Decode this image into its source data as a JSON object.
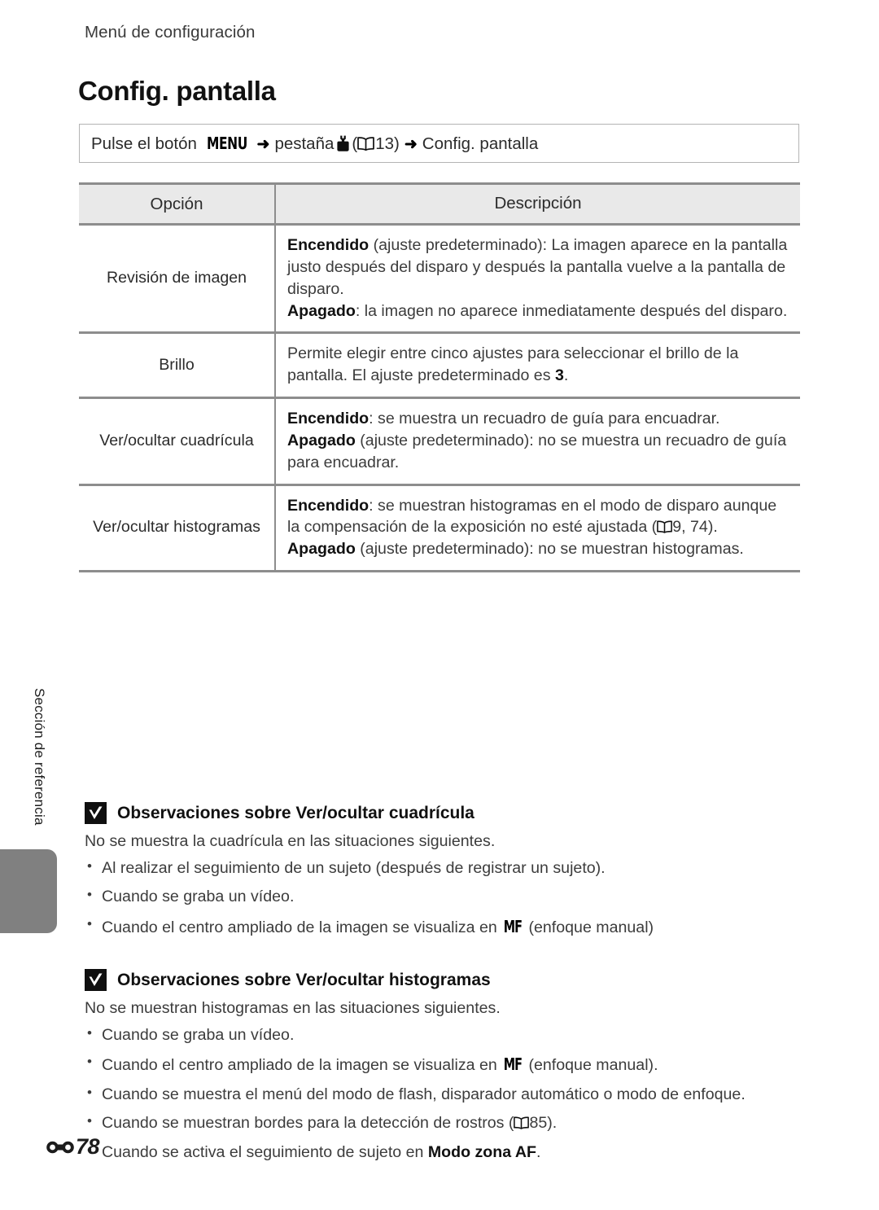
{
  "header": {
    "running_title": "Menú de configuración"
  },
  "page_title": "Config. pantalla",
  "path_bar": {
    "prefix": "Pulse el botón",
    "menu_button": "MENU",
    "arrow": "➜",
    "tab_word": "pestaña",
    "wrench_icon": "wrench-icon",
    "book_icon": "book-icon",
    "page_ref": "13",
    "open_paren": "(",
    "close_paren": ")",
    "arrow2": "➜",
    "destination": "Config. pantalla"
  },
  "table": {
    "headers": {
      "option": "Opción",
      "description": "Descripción"
    },
    "rows": [
      {
        "option": "Revisión de imagen",
        "lines": [
          {
            "bold": "Encendido",
            "rest": " (ajuste predeterminado): La imagen aparece en la pantalla justo después del disparo y después la pantalla vuelve a la pantalla de disparo."
          },
          {
            "bold": "Apagado",
            "rest": ": la imagen no aparece inmediatamente después del disparo."
          }
        ]
      },
      {
        "option": "Brillo",
        "lines": [
          {
            "bold": "",
            "rest": "Permite elegir entre cinco ajustes para seleccionar el brillo de la pantalla. El ajuste predeterminado es ",
            "trail_bold": "3",
            "trail": "."
          }
        ]
      },
      {
        "option": "Ver/ocultar cuadrícula",
        "lines": [
          {
            "bold": "Encendido",
            "rest": ": se muestra un recuadro de guía para encuadrar."
          },
          {
            "bold": "Apagado",
            "rest": " (ajuste predeterminado): no se muestra un recuadro de guía para encuadrar."
          }
        ]
      },
      {
        "option": "Ver/ocultar histogramas",
        "lines": [
          {
            "bold": "Encendido",
            "rest": ": se muestran histogramas en el modo de disparo aunque la compensación de la exposición no esté ajustada (",
            "book": "book-icon",
            "page_ref": "9, 74",
            "tail": ")."
          },
          {
            "bold": "Apagado",
            "rest": " (ajuste predeterminado): no se muestran histogramas."
          }
        ]
      }
    ]
  },
  "side_tab": {
    "label": "Sección de referencia"
  },
  "notes": [
    {
      "icon": "check-square-icon",
      "heading": "Observaciones sobre Ver/ocultar cuadrícula",
      "intro": "No se muestra la cuadrícula en las situaciones siguientes.",
      "bullets": [
        {
          "text": "Al realizar el seguimiento de un sujeto (después de registrar un sujeto)."
        },
        {
          "text": "Cuando se graba un vídeo."
        },
        {
          "pre": "Cuando el centro ampliado de la imagen se visualiza en ",
          "glyph": "MF",
          "post": " (enfoque manual)"
        }
      ]
    },
    {
      "icon": "check-square-icon",
      "heading": "Observaciones sobre Ver/ocultar histogramas",
      "intro": "No se muestran histogramas en las situaciones siguientes.",
      "bullets": [
        {
          "text": "Cuando se graba un vídeo."
        },
        {
          "pre": "Cuando el centro ampliado de la imagen se visualiza en ",
          "glyph": "MF",
          "post": " (enfoque manual)."
        },
        {
          "text": "Cuando se muestra el menú del modo de flash, disparador automático o modo de enfoque."
        },
        {
          "pre": "Cuando se muestran bordes para la detección de rostros (",
          "book": "book-icon",
          "page_ref": "85",
          "post": ")."
        },
        {
          "pre": "Cuando se activa el seguimiento de sujeto en ",
          "bold": "Modo zona AF",
          "post": "."
        }
      ]
    }
  ],
  "footer": {
    "icon": "reference-section-icon",
    "page_number": "78"
  },
  "colors": {
    "table_header_bg": "#e9e9e9",
    "rule": "#8d8d8d",
    "side_tab": "#808080",
    "body_text": "#3c3c3c",
    "bold_text": "#111111"
  }
}
